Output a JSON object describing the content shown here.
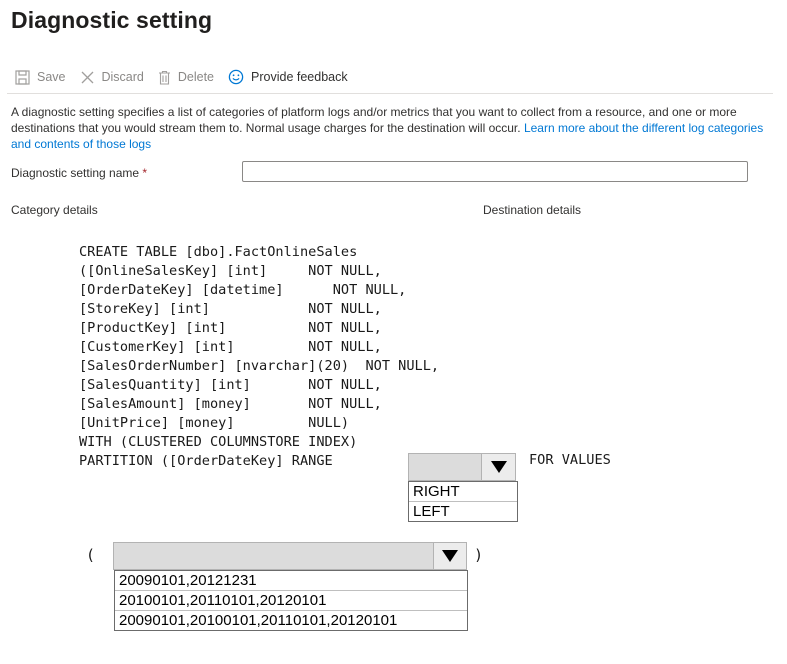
{
  "page": {
    "title": "Diagnostic setting"
  },
  "toolbar": {
    "save_label": "Save",
    "discard_label": "Discard",
    "delete_label": "Delete",
    "feedback_label": "Provide feedback"
  },
  "description": {
    "text": "A diagnostic setting specifies a list of categories of platform logs and/or metrics that you want to collect from a resource, and one or more destinations that you would stream them to. Normal usage charges for the destination will occur. ",
    "link_text": "Learn more about the different log categories and contents of those logs"
  },
  "form": {
    "name_label": "Diagnostic setting name",
    "required_mark": "*",
    "name_value": "",
    "category_details": "Category details",
    "destination_details": "Destination details"
  },
  "code": {
    "text": "CREATE TABLE [dbo].FactOnlineSales\n([OnlineSalesKey] [int]     NOT NULL,\n[OrderDateKey] [datetime]      NOT NULL,\n[StoreKey] [int]            NOT NULL,\n[ProductKey] [int]          NOT NULL,\n[CustomerKey] [int]         NOT NULL,\n[SalesOrderNumber] [nvarchar](20)  NOT NULL,\n[SalesQuantity] [int]       NOT NULL,\n[SalesAmount] [money]       NOT NULL,\n[UnitPrice] [money]         NULL)\nWITH (CLUSTERED COLUMNSTORE INDEX)\nPARTITION ([OrderDateKey] RANGE",
    "for_values": "FOR VALUES",
    "open_paren": "(",
    "close_paren": ")"
  },
  "range_dropdown": {
    "selected": "",
    "options": [
      "RIGHT",
      "LEFT"
    ]
  },
  "values_dropdown": {
    "selected": "",
    "options": [
      "20090101,20121231",
      "20100101,20110101,20120101",
      "20090101,20100101,20110101,20120101"
    ]
  },
  "icons": {
    "save": "save-icon",
    "discard": "close-icon",
    "delete": "trash-icon",
    "feedback": "smiley-icon",
    "dropdown": "caret-down-icon"
  }
}
